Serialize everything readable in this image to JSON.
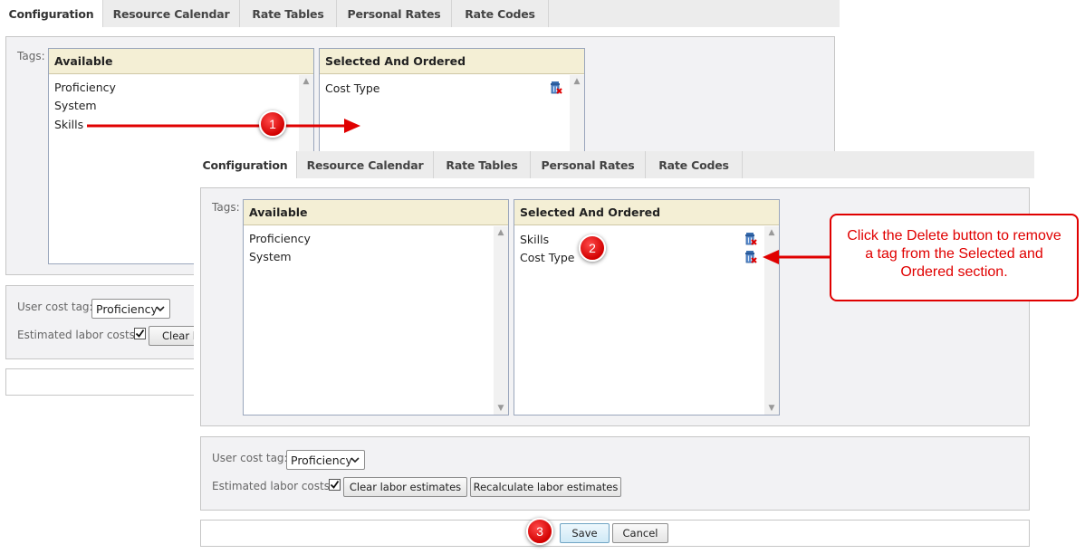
{
  "tabs": [
    "Configuration",
    "Resource Calendar",
    "Rate Tables",
    "Personal Rates",
    "Rate Codes"
  ],
  "active_tab": "Configuration",
  "tags": {
    "label": "Tags:",
    "available_header": "Available",
    "selected_header": "Selected And Ordered"
  },
  "before": {
    "available_items": [
      "Proficiency",
      "System",
      "Skills"
    ],
    "selected_items": [
      "Cost Type"
    ]
  },
  "after": {
    "available_items": [
      "Proficiency",
      "System"
    ],
    "selected_items": [
      "Skills",
      "Cost Type"
    ]
  },
  "settings": {
    "user_cost_tag_label": "User cost tag:",
    "user_cost_tag_value": "Proficiency",
    "estimated_labor_label": "Estimated labor costs:",
    "estimated_labor_checked": true,
    "clear_button": "Clear labor estimates",
    "clear_button_truncated": "Clear la",
    "recalc_button": "Recalculate labor estimates"
  },
  "footer": {
    "save": "Save",
    "cancel": "Cancel"
  },
  "annotations": {
    "step1": "1",
    "step2": "2",
    "step3": "3",
    "callout": "Click the Delete button to remove a tag from the Selected and Ordered section."
  },
  "colors": {
    "annotation_red": "#e00000",
    "list_header_bg": "#f4efd5",
    "panel_bg": "#f2f2f4"
  },
  "icons": {
    "delete": "trash-delete-icon",
    "dropdown": "chevron-down-icon",
    "scroll_up": "scroll-up-icon",
    "scroll_down": "scroll-down-icon"
  }
}
